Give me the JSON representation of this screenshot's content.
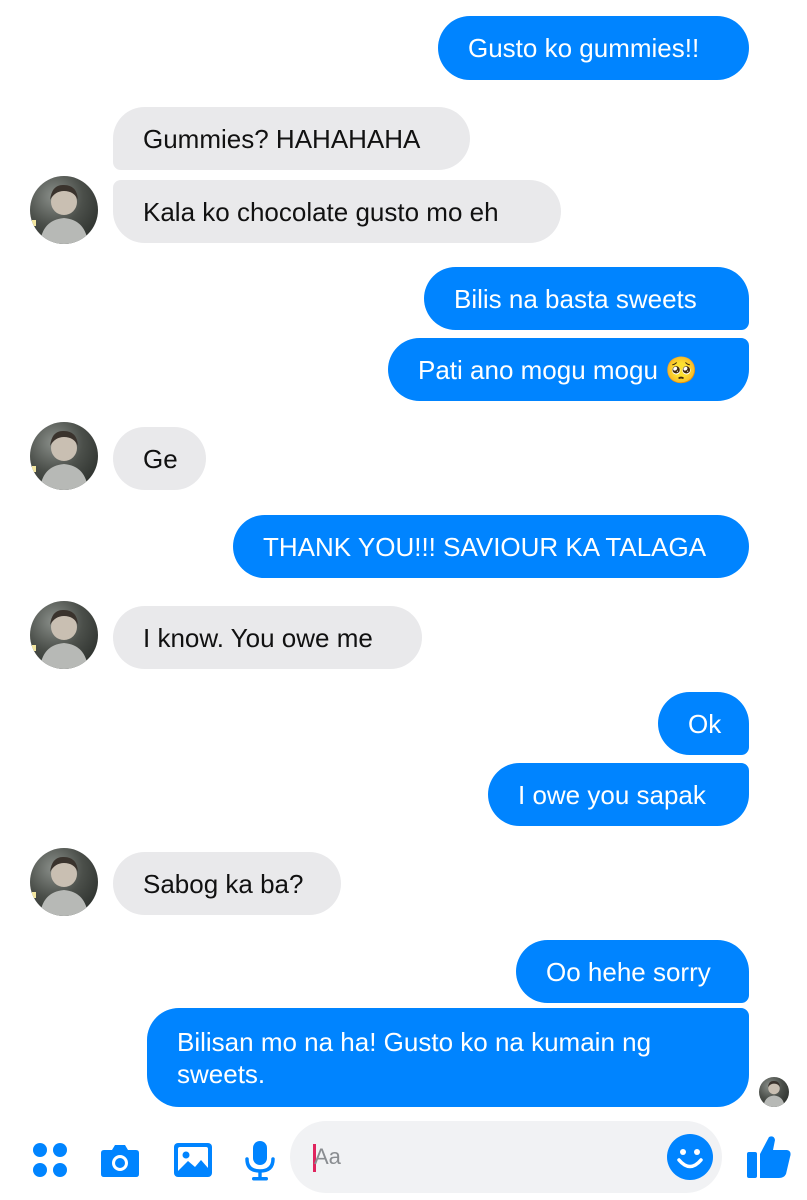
{
  "messages": [
    {
      "text": "Gusto ko gummies!!",
      "from": "me"
    },
    {
      "text": "Gummies? HAHAHAHA",
      "from": "them"
    },
    {
      "text": "Kala ko chocolate gusto mo eh",
      "from": "them"
    },
    {
      "text": "Bilis na basta sweets",
      "from": "me"
    },
    {
      "text": "Pati ano mogu mogu 🥺",
      "from": "me"
    },
    {
      "text": "Ge",
      "from": "them"
    },
    {
      "text": "THANK YOU!!! SAVIOUR KA TALAGA",
      "from": "me"
    },
    {
      "text": "I know. You owe me",
      "from": "them"
    },
    {
      "text": "Ok",
      "from": "me"
    },
    {
      "text": "I owe you sapak",
      "from": "me"
    },
    {
      "text": "Sabog ka ba?",
      "from": "them"
    },
    {
      "text": "Oo hehe sorry",
      "from": "me"
    },
    {
      "text": "Bilisan mo na ha! Gusto ko na kumain ng\nsweets.",
      "from": "me"
    }
  ],
  "composer": {
    "placeholder": "Aa",
    "icons": [
      "apps-icon",
      "camera-icon",
      "gallery-icon",
      "microphone-icon",
      "emoji-icon",
      "thumbs-up-icon"
    ]
  },
  "colors": {
    "outgoing_bubble": "#0084ff",
    "incoming_bubble": "#e9e9eb",
    "accent": "#0084ff"
  }
}
